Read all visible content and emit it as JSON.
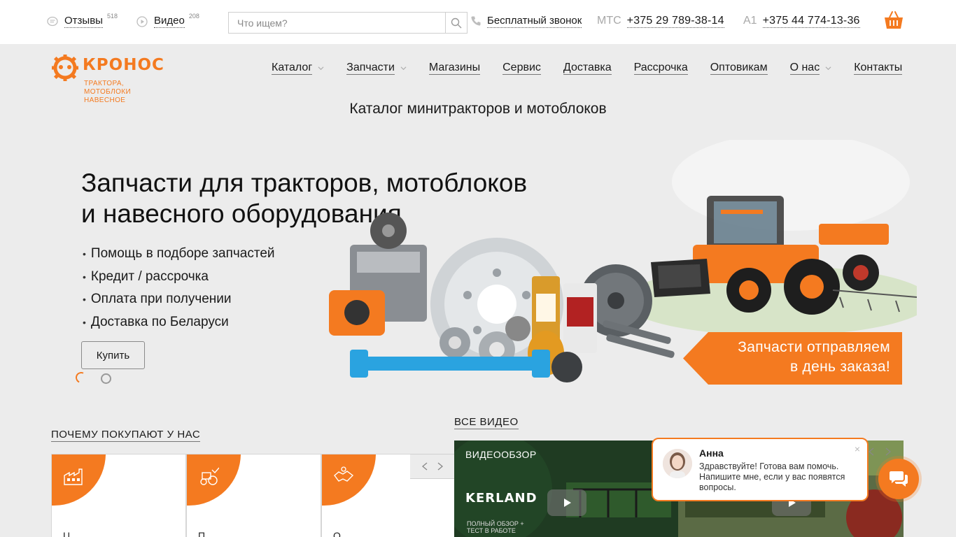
{
  "topbar": {
    "reviews": {
      "label": "Отзывы",
      "count": "518"
    },
    "videos": {
      "label": "Видео",
      "count": "208"
    },
    "search": {
      "placeholder": "Что ищем?"
    },
    "callback": "Бесплатный звонок",
    "phones": [
      {
        "operator": "МТС",
        "number": "+375 29 789-38-14"
      },
      {
        "operator": "А1",
        "number": "+375 44 774-13-36"
      }
    ]
  },
  "logo": {
    "name": "КРОНОС",
    "tagline": [
      "ТРАКТОРА,",
      "МОТОБЛОКИ",
      "НАВЕСНОЕ"
    ]
  },
  "nav": [
    {
      "label": "Каталог",
      "dropdown": true
    },
    {
      "label": "Запчасти",
      "dropdown": true
    },
    {
      "label": "Магазины",
      "dropdown": false
    },
    {
      "label": "Сервис",
      "dropdown": false
    },
    {
      "label": "Доставка",
      "dropdown": false
    },
    {
      "label": "Рассрочка",
      "dropdown": false
    },
    {
      "label": "Оптовикам",
      "dropdown": false
    },
    {
      "label": "О нас",
      "dropdown": true
    },
    {
      "label": "Контакты",
      "dropdown": false
    }
  ],
  "tagline": "Каталог минитракторов и мотоблоков",
  "hero": {
    "title_line1": "Запчасти для тракторов, мотоблоков",
    "title_line2": "и навесного оборудования",
    "bullets": [
      "Помощь в подборе запчастей",
      "Кредит / рассрочка",
      "Оплата при получении",
      "Доставка по Беларуси"
    ],
    "button": "Купить",
    "promo_line1": "Запчасти отправляем",
    "promo_line2": "в день заказа!"
  },
  "why": {
    "title": "Почему покупают у нас",
    "cards": [
      {
        "icon": "factory-icon",
        "text": "Ц"
      },
      {
        "icon": "tractor-icon",
        "text": "П"
      },
      {
        "icon": "handshake-icon",
        "text": "О"
      }
    ]
  },
  "videos": {
    "title": "Все видео",
    "tile_label": "Видеообзор",
    "brand": "KERLAND",
    "sub_line1": "ПОЛНЫЙ ОБЗОР +",
    "sub_line2": "ТЕСТ В РАБОТЕ"
  },
  "chat": {
    "name": "Анна",
    "message": "Здравствуйте! Готова вам помочь. Напишите мне, если у вас появятся вопросы.",
    "close": "×"
  },
  "colors": {
    "accent": "#f47a20",
    "background": "#ececec"
  }
}
